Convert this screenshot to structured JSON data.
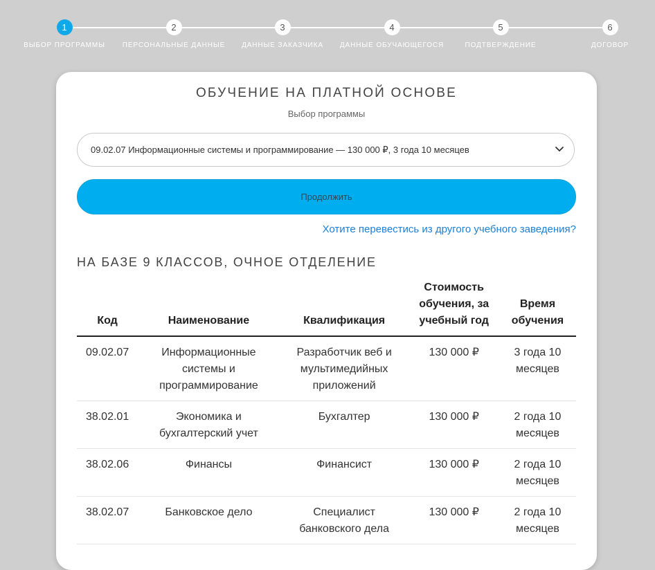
{
  "stepper": {
    "steps": [
      {
        "number": "1",
        "label": "ВЫБОР ПРОГРАММЫ"
      },
      {
        "number": "2",
        "label": "ПЕРСОНАЛЬНЫЕ ДАННЫЕ"
      },
      {
        "number": "3",
        "label": "ДАННЫЕ ЗАКАЗЧИКА"
      },
      {
        "number": "4",
        "label": "ДАННЫЕ ОБУЧАЮЩЕГОСЯ"
      },
      {
        "number": "5",
        "label": "ПОДТВЕРЖДЕНИЕ"
      },
      {
        "number": "6",
        "label": "ДОГОВОР"
      }
    ],
    "active_step": "1"
  },
  "card": {
    "title": "ОБУЧЕНИЕ НА ПЛАТНОЙ ОСНОВЕ",
    "subtitle": "Выбор программы",
    "program_select": {
      "selected": "09.02.07 Информационные системы и программирование — 130 000 ₽, 3 года 10 месяцев",
      "icon": "chevron-down-icon"
    },
    "continue_label": "Продолжить",
    "transfer_link": "Хотите перевестись из другого учебного заведения?"
  },
  "section": {
    "heading": "НА БАЗЕ 9 КЛАССОВ, ОЧНОЕ ОТДЕЛЕНИЕ",
    "table": {
      "headers": [
        "Код",
        "Наименование",
        "Квалификация",
        "Стоимость обучения, за учебный год",
        "Время обучения"
      ],
      "rows": [
        [
          "09.02.07",
          "Информационные системы и программирование",
          "Разработчик веб и мультимедийных приложений",
          "130 000 ₽",
          "3 года 10 месяцев"
        ],
        [
          "38.02.01",
          "Экономика и бухгалтерский учет",
          "Бухгалтер",
          "130 000 ₽",
          "2 года 10 месяцев"
        ],
        [
          "38.02.06",
          "Финансы",
          "Финансист",
          "130 000 ₽",
          "2 года 10 месяцев"
        ],
        [
          "38.02.07",
          "Банковское дело",
          "Специалист банковского дела",
          "130 000 ₽",
          "2 года 10 месяцев"
        ]
      ]
    }
  },
  "colors": {
    "background": "#cfcfcf",
    "accent": "#00aeef",
    "link": "#1b7fd6",
    "card": "#ffffff"
  }
}
